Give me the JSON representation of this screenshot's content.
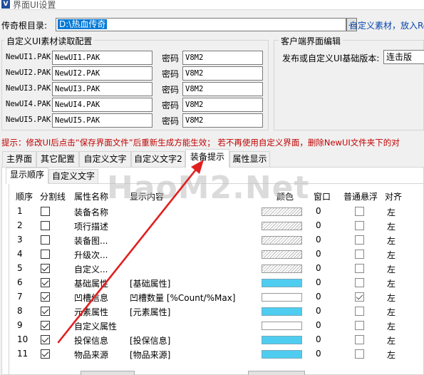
{
  "window": {
    "title": "界面UI设置"
  },
  "root_dir": {
    "label": "传奇根目录:",
    "value": "D:\\热血传奇",
    "browse_label": "...",
    "custom_link": "自定义素材，放入Re"
  },
  "ui_pak_group": {
    "title": "自定义UI素材读取配置",
    "password_label": "密码",
    "rows": [
      {
        "label": "NewUI1.PAK",
        "file": "NewUI1.PAK",
        "password": "V8M2"
      },
      {
        "label": "NewUI2.PAK",
        "file": "NewUI2.PAK",
        "password": "V8M2"
      },
      {
        "label": "NewUI3.PAK",
        "file": "NewUI3.PAK",
        "password": "V8M2"
      },
      {
        "label": "NewUI4.PAK",
        "file": "NewUI4.PAK",
        "password": "V8M2"
      },
      {
        "label": "NewUI5.PAK",
        "file": "NewUI5.PAK",
        "password": "V8M2"
      }
    ]
  },
  "client_group": {
    "title": "客户端界面编辑",
    "version_label": "发布或自定义UI基础版本:",
    "version_value": "连击版"
  },
  "tip": {
    "text": "提示：修改UI后点击“保存界面文件”后重新生成方能生效；    若不再使用自定义界面，删除NewUI文件夹下的对"
  },
  "tabs": [
    {
      "label": "主界面"
    },
    {
      "label": "其它配置"
    },
    {
      "label": "自定义文字"
    },
    {
      "label": "自定义文字2"
    },
    {
      "label": "装备提示"
    },
    {
      "label": "属性显示"
    }
  ],
  "subtabs": [
    {
      "label": "显示顺序"
    },
    {
      "label": "自定义文字"
    }
  ],
  "table": {
    "headers": {
      "order": "顺序",
      "divider": "分割线",
      "name": "属性名称",
      "content": "显示内容",
      "color": "颜色",
      "window": "窗口",
      "float": "普通悬浮",
      "align": "对齐"
    },
    "rows": [
      {
        "order": "1",
        "divider": false,
        "name": "装备名称",
        "content": "",
        "color": "hatch",
        "window": "0",
        "float": false,
        "align": "左"
      },
      {
        "order": "2",
        "divider": false,
        "name": "项行描述",
        "content": "",
        "color": "hatch",
        "window": "0",
        "float": false,
        "align": "左"
      },
      {
        "order": "3",
        "divider": false,
        "name": "装备图...",
        "content": "",
        "color": "hatch",
        "window": "0",
        "float": false,
        "align": "左"
      },
      {
        "order": "4",
        "divider": false,
        "name": "升级次...",
        "content": "",
        "color": "hatch",
        "window": "0",
        "float": false,
        "align": "左"
      },
      {
        "order": "5",
        "divider": true,
        "name": "自定义...",
        "content": "",
        "color": "hatch",
        "window": "0",
        "float": false,
        "align": "左"
      },
      {
        "order": "6",
        "divider": true,
        "name": "基础属性",
        "content": "[基础属性]",
        "color": "cyan",
        "window": "0",
        "float": false,
        "align": "左"
      },
      {
        "order": "7",
        "divider": true,
        "name": "凹槽信息",
        "content": "凹槽数量 [%Count/%Max]",
        "color": "white",
        "window": "0",
        "float": true,
        "align": "左"
      },
      {
        "order": "8",
        "divider": true,
        "name": "元素属性",
        "content": "[元素属性]",
        "color": "cyan",
        "window": "0",
        "float": false,
        "align": "左"
      },
      {
        "order": "9",
        "divider": true,
        "name": "自定义属性",
        "content": "",
        "color": "white",
        "window": "0",
        "float": false,
        "align": "左"
      },
      {
        "order": "10",
        "divider": true,
        "name": "投保信息",
        "content": "[投保信息]",
        "color": "cyan",
        "window": "0",
        "float": false,
        "align": "左"
      },
      {
        "order": "11",
        "divider": true,
        "name": "物品来源",
        "content": "[物品来源]",
        "color": "cyan",
        "window": "0",
        "float": false,
        "align": "左"
      }
    ]
  },
  "watermark": {
    "text": "HaoM2.Net"
  },
  "colors": {
    "accent": "#0078d7",
    "tip_red": "#c00000",
    "arrow_red": "#e02020",
    "swatch_cyan": "#4fcdf0",
    "link_blue": "#0645ad"
  }
}
